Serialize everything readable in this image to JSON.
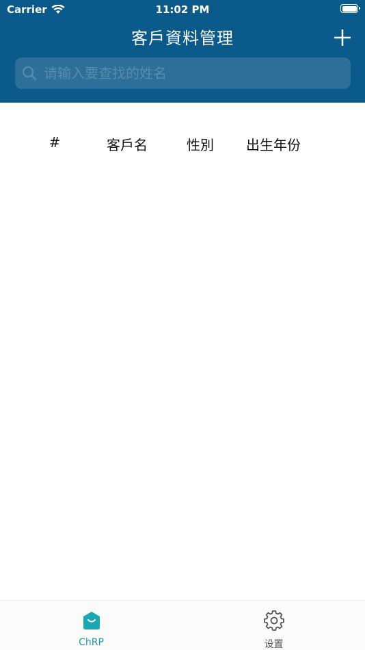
{
  "status_bar": {
    "carrier": "Carrier",
    "time": "11:02 PM",
    "wifi_icon": "wifi-icon",
    "battery_icon": "battery-icon"
  },
  "nav": {
    "title": "客戶資料管理",
    "add_icon": "plus-icon"
  },
  "search": {
    "placeholder": "请输入要查找的姓名",
    "value": "",
    "icon": "search-icon"
  },
  "table": {
    "columns": [
      "#",
      "客戶名",
      "性別",
      "出生年份"
    ],
    "rows": []
  },
  "tab_bar": {
    "tabs": [
      {
        "label": "ChRP",
        "icon": "chrp-icon",
        "active": true
      },
      {
        "label": "设置",
        "icon": "gear-icon",
        "active": false
      }
    ]
  },
  "colors": {
    "header_bg": "#0b5a8c",
    "search_bg": "#2c7099",
    "active_tab": "#1a9aa5",
    "inactive_tab": "#555555"
  }
}
